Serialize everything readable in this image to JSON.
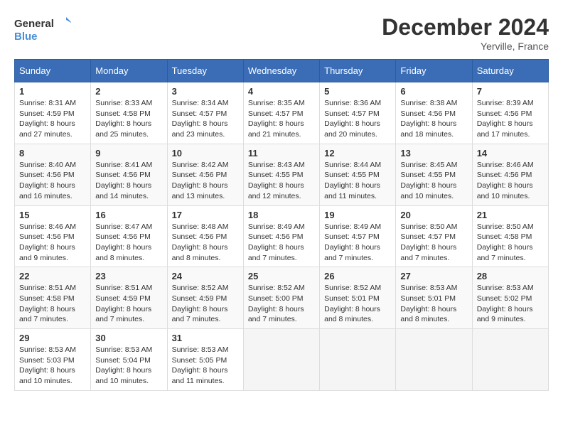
{
  "logo": {
    "line1": "General",
    "line2": "Blue"
  },
  "title": "December 2024",
  "location": "Yerville, France",
  "days_header": [
    "Sunday",
    "Monday",
    "Tuesday",
    "Wednesday",
    "Thursday",
    "Friday",
    "Saturday"
  ],
  "weeks": [
    [
      {
        "day": "1",
        "rise": "8:31 AM",
        "set": "4:59 PM",
        "daylight": "8 hours and 27 minutes."
      },
      {
        "day": "2",
        "rise": "8:33 AM",
        "set": "4:58 PM",
        "daylight": "8 hours and 25 minutes."
      },
      {
        "day": "3",
        "rise": "8:34 AM",
        "set": "4:57 PM",
        "daylight": "8 hours and 23 minutes."
      },
      {
        "day": "4",
        "rise": "8:35 AM",
        "set": "4:57 PM",
        "daylight": "8 hours and 21 minutes."
      },
      {
        "day": "5",
        "rise": "8:36 AM",
        "set": "4:57 PM",
        "daylight": "8 hours and 20 minutes."
      },
      {
        "day": "6",
        "rise": "8:38 AM",
        "set": "4:56 PM",
        "daylight": "8 hours and 18 minutes."
      },
      {
        "day": "7",
        "rise": "8:39 AM",
        "set": "4:56 PM",
        "daylight": "8 hours and 17 minutes."
      }
    ],
    [
      {
        "day": "8",
        "rise": "8:40 AM",
        "set": "4:56 PM",
        "daylight": "8 hours and 16 minutes."
      },
      {
        "day": "9",
        "rise": "8:41 AM",
        "set": "4:56 PM",
        "daylight": "8 hours and 14 minutes."
      },
      {
        "day": "10",
        "rise": "8:42 AM",
        "set": "4:56 PM",
        "daylight": "8 hours and 13 minutes."
      },
      {
        "day": "11",
        "rise": "8:43 AM",
        "set": "4:55 PM",
        "daylight": "8 hours and 12 minutes."
      },
      {
        "day": "12",
        "rise": "8:44 AM",
        "set": "4:55 PM",
        "daylight": "8 hours and 11 minutes."
      },
      {
        "day": "13",
        "rise": "8:45 AM",
        "set": "4:55 PM",
        "daylight": "8 hours and 10 minutes."
      },
      {
        "day": "14",
        "rise": "8:46 AM",
        "set": "4:56 PM",
        "daylight": "8 hours and 10 minutes."
      }
    ],
    [
      {
        "day": "15",
        "rise": "8:46 AM",
        "set": "4:56 PM",
        "daylight": "8 hours and 9 minutes."
      },
      {
        "day": "16",
        "rise": "8:47 AM",
        "set": "4:56 PM",
        "daylight": "8 hours and 8 minutes."
      },
      {
        "day": "17",
        "rise": "8:48 AM",
        "set": "4:56 PM",
        "daylight": "8 hours and 8 minutes."
      },
      {
        "day": "18",
        "rise": "8:49 AM",
        "set": "4:56 PM",
        "daylight": "8 hours and 7 minutes."
      },
      {
        "day": "19",
        "rise": "8:49 AM",
        "set": "4:57 PM",
        "daylight": "8 hours and 7 minutes."
      },
      {
        "day": "20",
        "rise": "8:50 AM",
        "set": "4:57 PM",
        "daylight": "8 hours and 7 minutes."
      },
      {
        "day": "21",
        "rise": "8:50 AM",
        "set": "4:58 PM",
        "daylight": "8 hours and 7 minutes."
      }
    ],
    [
      {
        "day": "22",
        "rise": "8:51 AM",
        "set": "4:58 PM",
        "daylight": "8 hours and 7 minutes."
      },
      {
        "day": "23",
        "rise": "8:51 AM",
        "set": "4:59 PM",
        "daylight": "8 hours and 7 minutes."
      },
      {
        "day": "24",
        "rise": "8:52 AM",
        "set": "4:59 PM",
        "daylight": "8 hours and 7 minutes."
      },
      {
        "day": "25",
        "rise": "8:52 AM",
        "set": "5:00 PM",
        "daylight": "8 hours and 7 minutes."
      },
      {
        "day": "26",
        "rise": "8:52 AM",
        "set": "5:01 PM",
        "daylight": "8 hours and 8 minutes."
      },
      {
        "day": "27",
        "rise": "8:53 AM",
        "set": "5:01 PM",
        "daylight": "8 hours and 8 minutes."
      },
      {
        "day": "28",
        "rise": "8:53 AM",
        "set": "5:02 PM",
        "daylight": "8 hours and 9 minutes."
      }
    ],
    [
      {
        "day": "29",
        "rise": "8:53 AM",
        "set": "5:03 PM",
        "daylight": "8 hours and 10 minutes."
      },
      {
        "day": "30",
        "rise": "8:53 AM",
        "set": "5:04 PM",
        "daylight": "8 hours and 10 minutes."
      },
      {
        "day": "31",
        "rise": "8:53 AM",
        "set": "5:05 PM",
        "daylight": "8 hours and 11 minutes."
      },
      null,
      null,
      null,
      null
    ]
  ]
}
